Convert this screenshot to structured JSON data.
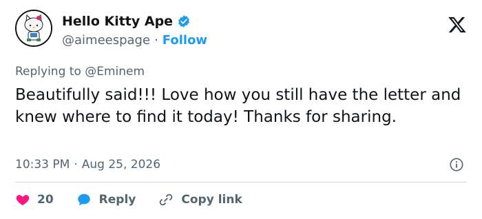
{
  "author": {
    "display_name": "Hello Kitty Ape",
    "handle": "@aimeespage",
    "separator": "·",
    "follow_label": "Follow",
    "verified": true
  },
  "reply": {
    "prefix": "Replying to",
    "mention": "@Eminem"
  },
  "tweet": {
    "text": "Beautifully said!!!  Love how you still have the letter and knew where to find it today! Thanks for sharing."
  },
  "meta": {
    "time": "10:33 PM",
    "separator": "·",
    "date": "Aug 25, 2026"
  },
  "actions": {
    "likes_count": "20",
    "reply_label": "Reply",
    "copy_label": "Copy link"
  },
  "colors": {
    "accent": "#1d9bf0",
    "like": "#f91880",
    "text": "#0f1419",
    "muted": "#536471"
  },
  "icons": [
    "verified-badge-icon",
    "x-logo-icon",
    "info-icon",
    "heart-icon",
    "reply-bubble-icon",
    "link-icon"
  ]
}
